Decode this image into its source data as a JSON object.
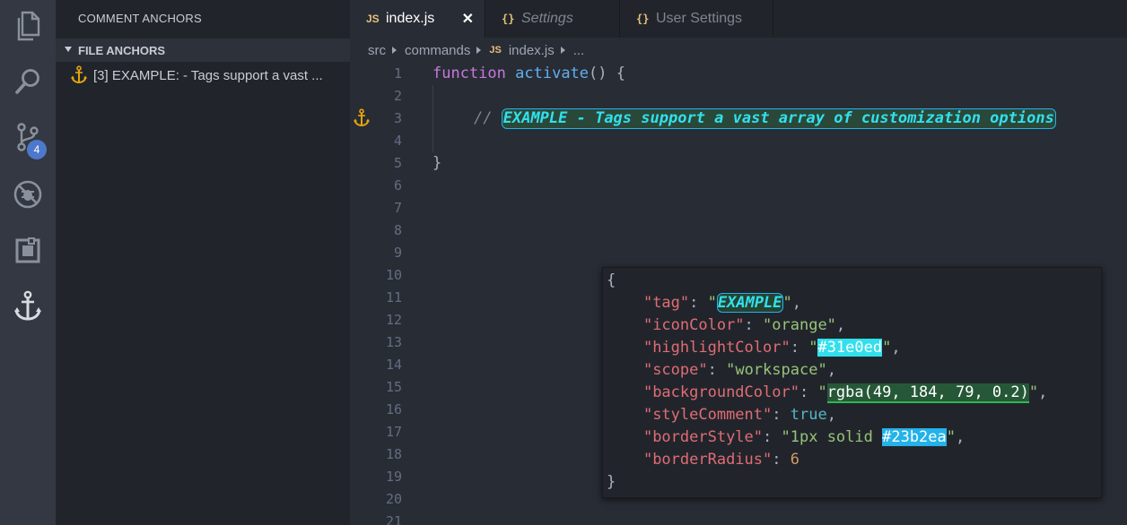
{
  "activity_bar": {
    "icons": [
      "files-icon",
      "search-icon",
      "source-control-icon",
      "debug-icon",
      "extensions-icon",
      "anchor-icon"
    ],
    "source_control_badge": "4"
  },
  "sidebar": {
    "title": "COMMENT ANCHORS",
    "section": "FILE ANCHORS",
    "items": [
      {
        "label": "[3] EXAMPLE: - Tags support a vast ...",
        "icon_color": "#e5a50a"
      }
    ]
  },
  "tabs": [
    {
      "icon": "JS",
      "label": "index.js",
      "active": true,
      "close": "✕"
    },
    {
      "icon": "{}",
      "label": "Settings",
      "active": false
    },
    {
      "icon": "{}",
      "label": "User Settings",
      "active": false
    }
  ],
  "breadcrumb": {
    "parts": [
      "src",
      "commands"
    ],
    "file_icon": "JS",
    "file": "index.js",
    "more": "..."
  },
  "editor": {
    "line_numbers": [
      "1",
      "2",
      "3",
      "4",
      "5",
      "6",
      "7",
      "8",
      "9",
      "10",
      "11",
      "12",
      "13",
      "14",
      "15",
      "16",
      "17",
      "18",
      "19",
      "20",
      "21"
    ],
    "code": {
      "line1_kw": "function",
      "line1_fn": "activate",
      "line1_rest": "() {",
      "line3_comment": "//",
      "line3_tag": "EXAMPLE - Tags support a vast array of customization options",
      "line5": "}"
    }
  },
  "popup": {
    "open_brace": "{",
    "close_brace": "}",
    "tag_key": "\"tag\"",
    "tag_value": "EXAMPLE",
    "icon_color_key": "\"iconColor\"",
    "icon_color_value": "\"orange\"",
    "highlight_key": "\"highlightColor\"",
    "highlight_value": "#31e0ed",
    "scope_key": "\"scope\"",
    "scope_value": "\"workspace\"",
    "background_key": "\"backgroundColor\"",
    "background_value": "rgba(49, 184, 79, 0.2)",
    "style_comment_key": "\"styleComment\"",
    "style_comment_value": "true",
    "border_style_key": "\"borderStyle\"",
    "border_style_prefix": "1px solid ",
    "border_style_color": "#23b2ea",
    "border_radius_key": "\"borderRadius\"",
    "border_radius_value": "6"
  },
  "colors": {
    "highlight": "#31e0ed",
    "border": "#23b2ea",
    "background": "rgba(49, 184, 79, 0.2)",
    "anchor_orange": "#e5a50a"
  }
}
